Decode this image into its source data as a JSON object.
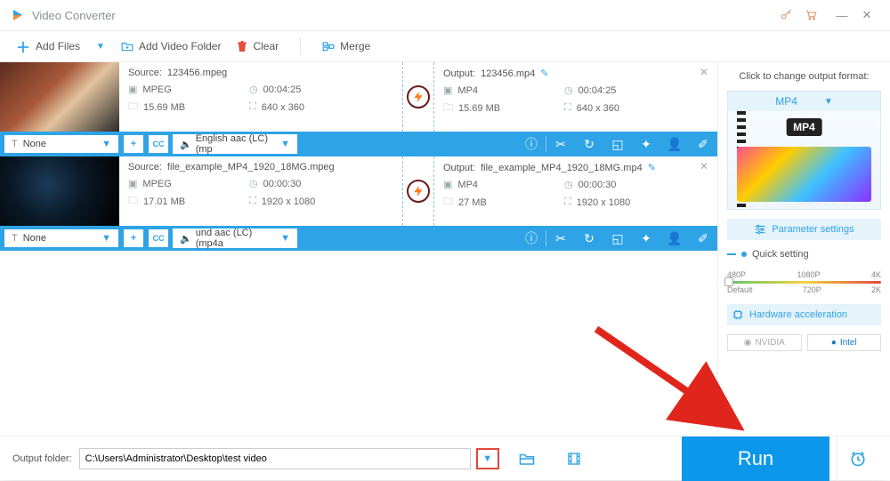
{
  "title": "Video Converter",
  "toolbar": {
    "add_files": "Add Files",
    "add_folder": "Add Video Folder",
    "clear": "Clear",
    "merge": "Merge"
  },
  "files": [
    {
      "source_label": "Source:",
      "source_name": "123456.mpeg",
      "output_label": "Output:",
      "output_name": "123456.mp4",
      "src_format": "MPEG",
      "out_format": "MP4",
      "src_duration": "00:04:25",
      "out_duration": "00:04:25",
      "src_size": "15.69 MB",
      "out_size": "15.69 MB",
      "src_res": "640 x 360",
      "out_res": "640 x 360",
      "subtitle": "None",
      "audio": "English aac (LC) (mp"
    },
    {
      "source_label": "Source:",
      "source_name": "file_example_MP4_1920_18MG.mpeg",
      "output_label": "Output:",
      "output_name": "file_example_MP4_1920_18MG.mp4",
      "src_format": "MPEG",
      "out_format": "MP4",
      "src_duration": "00:00:30",
      "out_duration": "00:00:30",
      "src_size": "17.01 MB",
      "out_size": "27 MB",
      "src_res": "1920 x 1080",
      "out_res": "1920 x 1080",
      "subtitle": "None",
      "audio": "und aac (LC) (mp4a"
    }
  ],
  "side": {
    "click_label": "Click to change output format:",
    "format_name": "MP4",
    "badge": "MP4",
    "param_btn": "Parameter settings",
    "quick_label": "Quick setting",
    "res_480": "480P",
    "res_720": "720P",
    "res_1080": "1080P",
    "res_2k": "2K",
    "res_4k": "4K",
    "res_default": "Default",
    "hw_label": "Hardware acceleration",
    "nvidia": "NVIDIA",
    "intel": "Intel"
  },
  "footer": {
    "label": "Output folder:",
    "path": "C:\\Users\\Administrator\\Desktop\\test video",
    "run": "Run"
  },
  "subtitle_icon": "T",
  "plus": "+",
  "cc": "CC"
}
